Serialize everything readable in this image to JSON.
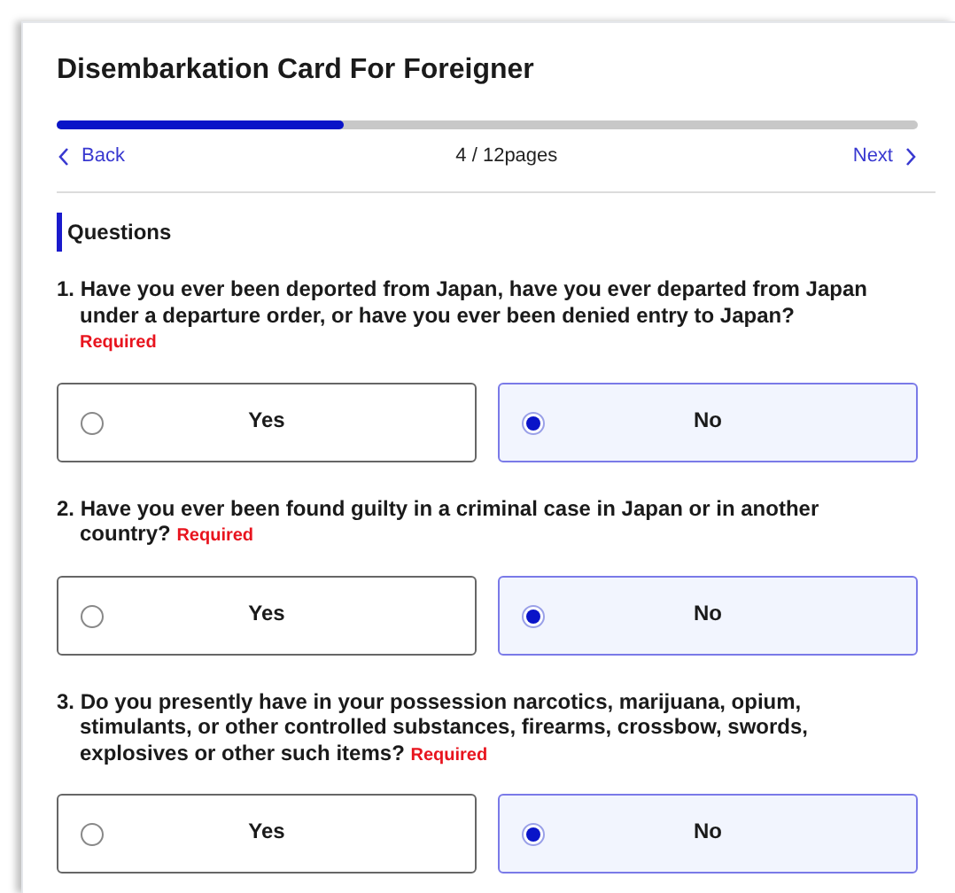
{
  "title": "Disembarkation Card For Foreigner",
  "progress": {
    "level": 0.333
  },
  "nav": {
    "back": "Back",
    "page": "4 / 12pages",
    "next": "Next"
  },
  "section_title": "Questions",
  "questions": [
    {
      "text": "1. Have you ever been deported from Japan, have you ever departed from Japan under a departure order, or have you ever been denied entry to Japan?",
      "required": "Required",
      "options": [
        {
          "label": "Yes",
          "selected": false
        },
        {
          "label": "No",
          "selected": true
        }
      ]
    },
    {
      "text": "2. Have you ever been found guilty in a criminal case in Japan or in another country?",
      "required": "Required",
      "options": [
        {
          "label": "Yes",
          "selected": false
        },
        {
          "label": "No",
          "selected": true
        }
      ]
    },
    {
      "text": "3. Do you presently have in your possession narcotics, marijuana, opium, stimulants, or other controlled substances, firearms, crossbow, swords, explosives or other such items?",
      "required": "Required",
      "options": [
        {
          "label": "Yes",
          "selected": false
        },
        {
          "label": "No",
          "selected": true
        }
      ]
    }
  ]
}
